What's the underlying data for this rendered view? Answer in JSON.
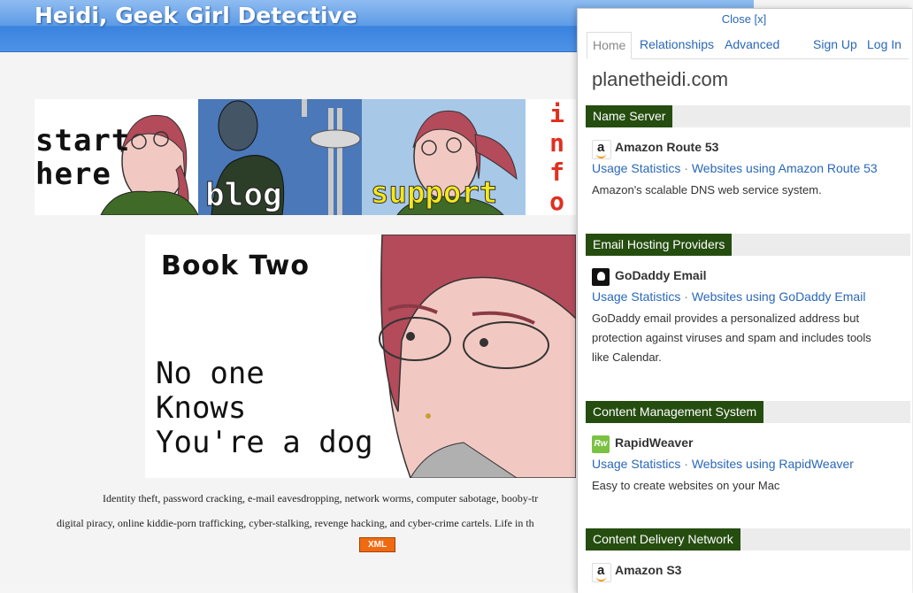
{
  "site": {
    "title": "Heidi, Geek Girl Detective",
    "nav": [
      "start here",
      "blog",
      "support",
      "info"
    ],
    "book_title": "Book Two",
    "book_tagline": "No one\nKnows\nYou're a dog",
    "blurb_line1": "Identity theft, password cracking, e-mail eavesdropping, network worms, computer sabotage, booby-tr",
    "blurb_line2": "digital piracy, online kiddie-porn trafficking, cyber-stalking, revenge hacking, and cyber-crime cartels. Life in th",
    "xml_badge": "XML"
  },
  "panel": {
    "close_label": "Close [x]",
    "tabs": [
      "Home",
      "Relationships",
      "Advanced",
      "Sign Up",
      "Log In"
    ],
    "active_tab": "Home",
    "domain": "planetheidi.com",
    "sections": [
      {
        "category": "Name Server",
        "tech": "Amazon Route 53",
        "icon": "amazon-icon",
        "usage_link": "Usage Statistics",
        "websites_link": "Websites using Amazon Route 53",
        "description": "Amazon's scalable DNS web service system."
      },
      {
        "category": "Email Hosting Providers",
        "tech": "GoDaddy Email",
        "icon": "godaddy-icon",
        "usage_link": "Usage Statistics",
        "websites_link": "Websites using GoDaddy Email",
        "description": "GoDaddy email provides a personalized address but protection against viruses and spam and includes tools like Calendar."
      },
      {
        "category": "Content Management System",
        "tech": "RapidWeaver",
        "icon": "rapidweaver-icon",
        "icon_text": "Rw",
        "usage_link": "Usage Statistics",
        "websites_link": "Websites using RapidWeaver",
        "description": "Easy to create websites on your Mac"
      },
      {
        "category": "Content Delivery Network",
        "tech": "Amazon S3",
        "icon": "amazon-icon"
      }
    ],
    "link_separator": "·"
  },
  "colors": {
    "header_blue": "#4d92e8",
    "section_label_bg": "#254d10",
    "link_blue": "#2a68b8",
    "xml_orange": "#f06a10"
  }
}
